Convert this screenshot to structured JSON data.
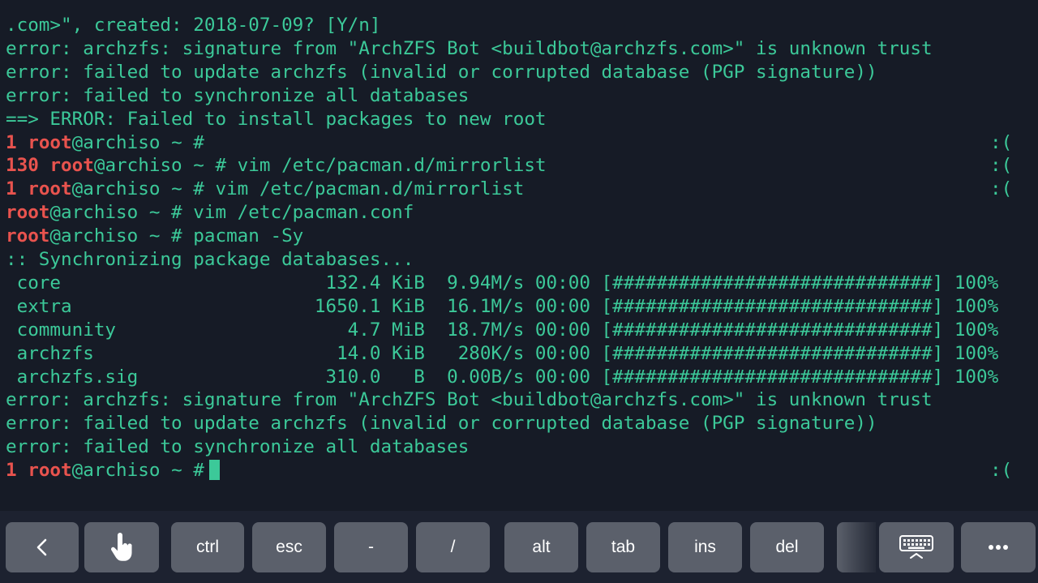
{
  "terminal": {
    "lines": [
      {
        "num": "",
        "user": "",
        "text": ".com>\", created: 2018-07-09? [Y/n]",
        "frown": ""
      },
      {
        "num": "",
        "user": "",
        "text": "error: archzfs: signature from \"ArchZFS Bot <buildbot@archzfs.com>\" is unknown trust",
        "frown": ""
      },
      {
        "num": "",
        "user": "",
        "text": "error: failed to update archzfs (invalid or corrupted database (PGP signature))",
        "frown": ""
      },
      {
        "num": "",
        "user": "",
        "text": "error: failed to synchronize all databases",
        "frown": ""
      },
      {
        "num": "",
        "user": "",
        "text": "==> ERROR: Failed to install packages to new root",
        "frown": ""
      },
      {
        "num": "1 ",
        "user": "root",
        "text": "@archiso ~ #",
        "frown": ":("
      },
      {
        "num": "130 ",
        "user": "root",
        "text": "@archiso ~ # vim /etc/pacman.d/mirrorlist",
        "frown": ":("
      },
      {
        "num": "1 ",
        "user": "root",
        "text": "@archiso ~ # vim /etc/pacman.d/mirrorlist",
        "frown": ":("
      },
      {
        "num": "",
        "user": "root",
        "text": "@archiso ~ # vim /etc/pacman.conf",
        "frown": ""
      },
      {
        "num": "",
        "user": "root",
        "text": "@archiso ~ # pacman -Sy",
        "frown": ""
      },
      {
        "num": "",
        "user": "",
        "text": ":: Synchronizing package databases...",
        "frown": ""
      },
      {
        "num": "",
        "user": "",
        "text": " core                        132.4 KiB  9.94M/s 00:00 [#############################] 100%",
        "frown": ""
      },
      {
        "num": "",
        "user": "",
        "text": " extra                      1650.1 KiB  16.1M/s 00:00 [#############################] 100%",
        "frown": ""
      },
      {
        "num": "",
        "user": "",
        "text": " community                     4.7 MiB  18.7M/s 00:00 [#############################] 100%",
        "frown": ""
      },
      {
        "num": "",
        "user": "",
        "text": " archzfs                      14.0 KiB   280K/s 00:00 [#############################] 100%",
        "frown": ""
      },
      {
        "num": "",
        "user": "",
        "text": " archzfs.sig                 310.0   B  0.00B/s 00:00 [#############################] 100%",
        "frown": ""
      },
      {
        "num": "",
        "user": "",
        "text": "error: archzfs: signature from \"ArchZFS Bot <buildbot@archzfs.com>\" is unknown trust",
        "frown": ""
      },
      {
        "num": "",
        "user": "",
        "text": "error: failed to update archzfs (invalid or corrupted database (PGP signature))",
        "frown": ""
      },
      {
        "num": "",
        "user": "",
        "text": "error: failed to synchronize all databases",
        "frown": ""
      },
      {
        "num": "1 ",
        "user": "root",
        "text": "@archiso ~ #",
        "frown": ":("
      }
    ]
  },
  "keybar": {
    "keys": [
      {
        "name": "back-key",
        "label": "",
        "icon": "chevron-left-icon"
      },
      {
        "name": "touch-mode-key",
        "label": "",
        "icon": "hand-pointer-icon"
      },
      {
        "name": "ctrl-key",
        "label": "ctrl",
        "icon": ""
      },
      {
        "name": "esc-key",
        "label": "esc",
        "icon": ""
      },
      {
        "name": "dash-key",
        "label": "-",
        "icon": ""
      },
      {
        "name": "slash-key",
        "label": "/",
        "icon": ""
      },
      {
        "name": "alt-key",
        "label": "alt",
        "icon": ""
      },
      {
        "name": "tab-key",
        "label": "tab",
        "icon": ""
      },
      {
        "name": "ins-key",
        "label": "ins",
        "icon": ""
      },
      {
        "name": "del-key",
        "label": "del",
        "icon": ""
      },
      {
        "name": "keyboard-toggle-key",
        "label": "",
        "icon": "keyboard-icon"
      },
      {
        "name": "more-key",
        "label": "",
        "icon": "more-dots-icon"
      }
    ]
  },
  "colors": {
    "background": "#161b26",
    "text": "#3cc999",
    "prompt_red": "#e8534e",
    "key": "#5b606b"
  }
}
